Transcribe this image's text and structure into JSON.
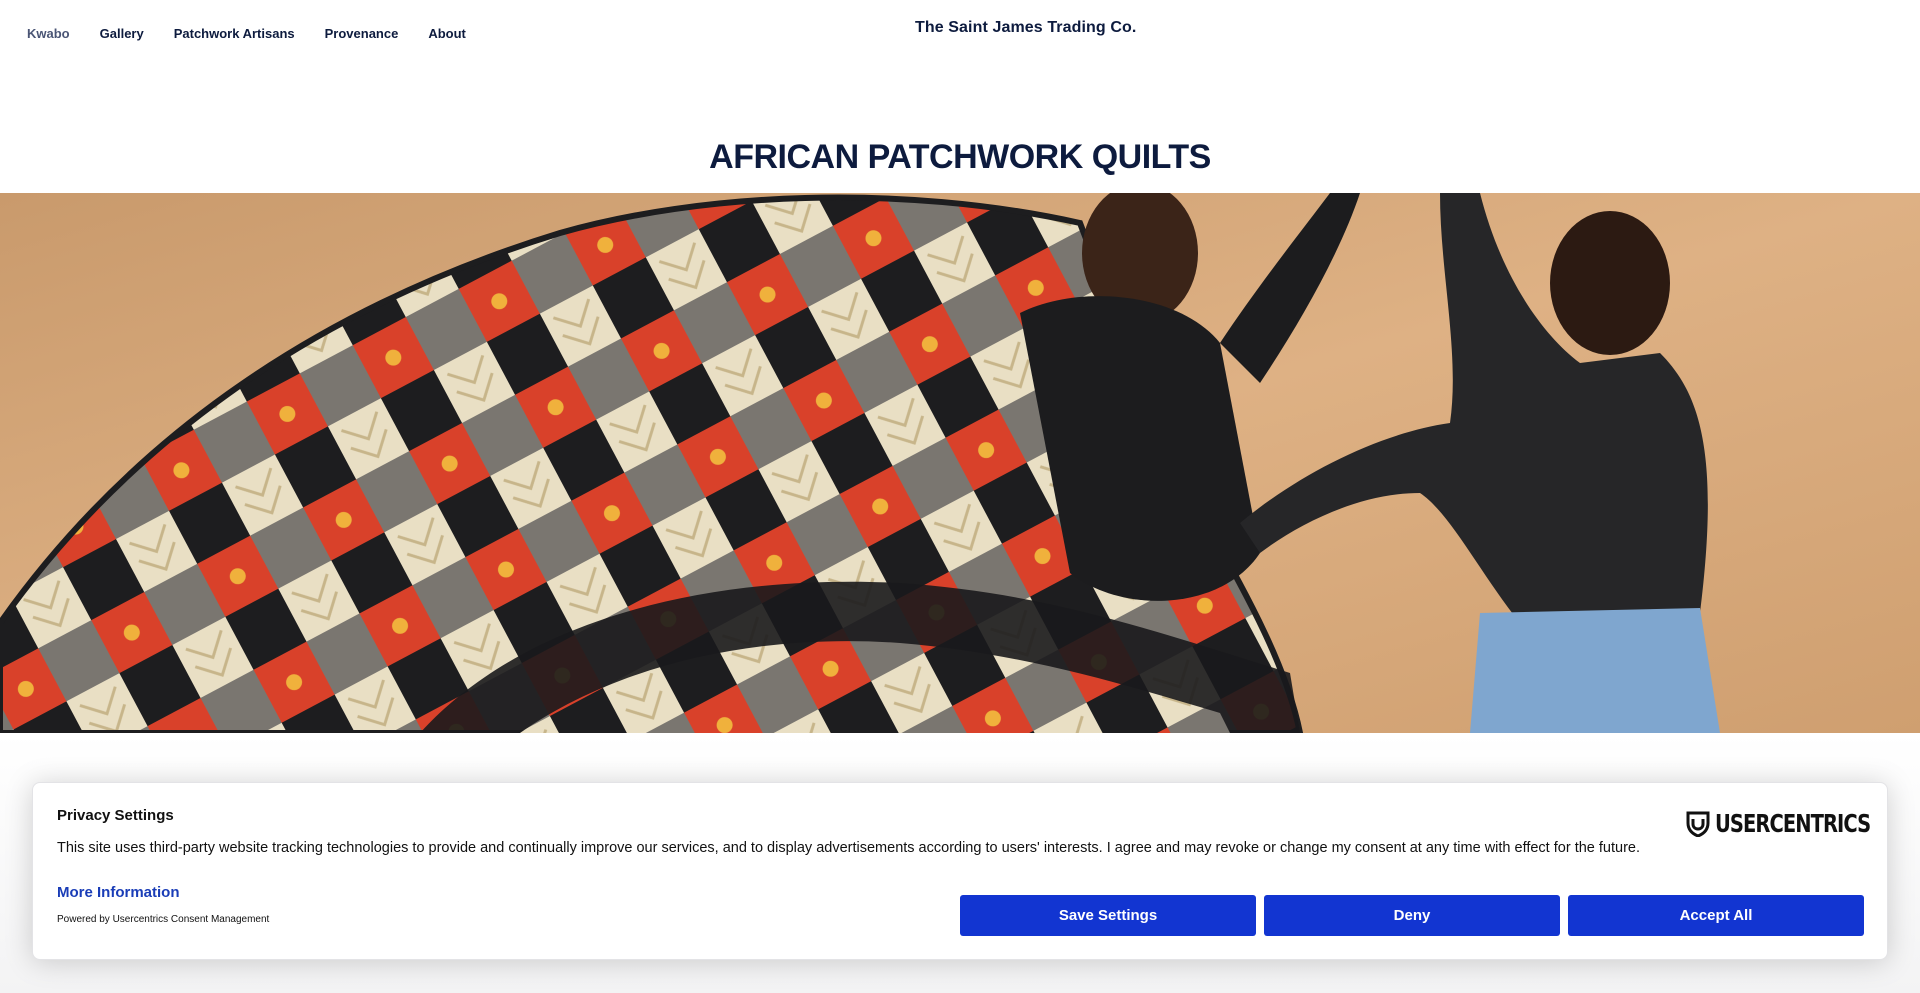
{
  "nav": {
    "items": [
      {
        "label": "Kwabo",
        "active": true
      },
      {
        "label": "Gallery"
      },
      {
        "label": "Patchwork Artisans"
      },
      {
        "label": "Provenance"
      },
      {
        "label": "About"
      }
    ]
  },
  "brand": "The Saint James Trading Co.",
  "page_title": "AFRICAN PATCHWORK QUILTS",
  "consent": {
    "title": "Privacy Settings",
    "text": "This site uses third-party website tracking technologies to provide and continually improve our services, and to display advertisements according to users' interests. I agree and may revoke or change my consent at any time with effect for the future.",
    "more_info": "More Information",
    "powered_by": "Powered by Usercentrics Consent Management",
    "logo_text": "USERCENTRICS",
    "buttons": {
      "save": "Save Settings",
      "deny": "Deny",
      "accept": "Accept All"
    }
  },
  "colors": {
    "navy": "#0d1b3e",
    "accent_blue": "#1235d1",
    "link_blue": "#1a3db7",
    "sand": "#d7a878"
  }
}
